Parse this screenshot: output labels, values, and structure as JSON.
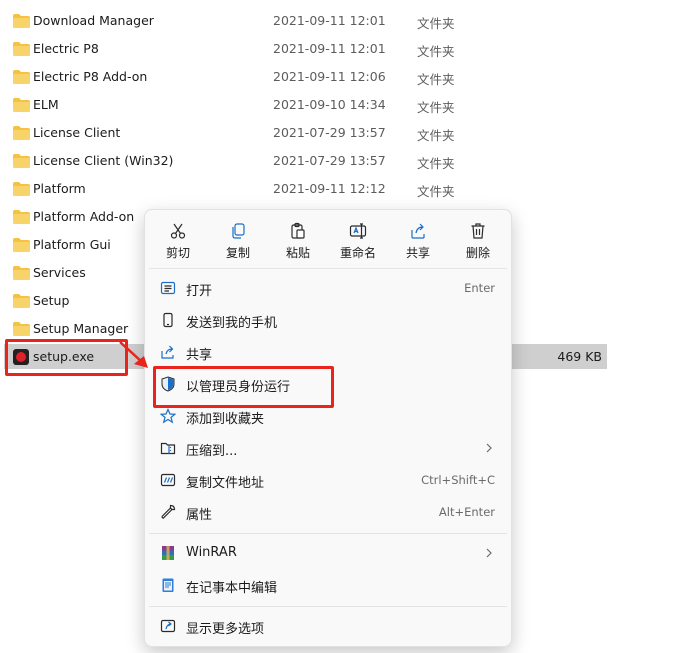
{
  "files": [
    {
      "name": "Download Manager",
      "date": "2021-09-11 12:01",
      "type": "文件夹",
      "icon": "folder-icon"
    },
    {
      "name": "Electric P8",
      "date": "2021-09-11 12:01",
      "type": "文件夹",
      "icon": "folder-icon"
    },
    {
      "name": "Electric P8 Add-on",
      "date": "2021-09-11 12:06",
      "type": "文件夹",
      "icon": "folder-icon"
    },
    {
      "name": "ELM",
      "date": "2021-09-10 14:34",
      "type": "文件夹",
      "icon": "folder-icon"
    },
    {
      "name": "License Client",
      "date": "2021-07-29 13:57",
      "type": "文件夹",
      "icon": "folder-icon"
    },
    {
      "name": "License Client (Win32)",
      "date": "2021-07-29 13:57",
      "type": "文件夹",
      "icon": "folder-icon"
    },
    {
      "name": "Platform",
      "date": "2021-09-11 12:12",
      "type": "文件夹",
      "icon": "folder-icon"
    },
    {
      "name": "Platform Add-on",
      "date": "",
      "type": "",
      "icon": "folder-icon"
    },
    {
      "name": "Platform Gui",
      "date": "",
      "type": "",
      "icon": "folder-icon"
    },
    {
      "name": "Services",
      "date": "",
      "type": "",
      "icon": "folder-icon"
    },
    {
      "name": "Setup",
      "date": "",
      "type": "",
      "icon": "folder-icon"
    },
    {
      "name": "Setup Manager",
      "date": "",
      "type": "",
      "icon": "folder-icon"
    }
  ],
  "selected_file": {
    "name": "setup.exe",
    "size": "469 KB",
    "icon": "exe-icon"
  },
  "context_menu": {
    "toolbar": [
      {
        "label": "剪切",
        "icon": "scissors-icon"
      },
      {
        "label": "复制",
        "icon": "copy-icon"
      },
      {
        "label": "粘贴",
        "icon": "paste-icon"
      },
      {
        "label": "重命名",
        "icon": "rename-icon"
      },
      {
        "label": "共享",
        "icon": "share-icon"
      },
      {
        "label": "删除",
        "icon": "trash-icon"
      }
    ],
    "items": [
      {
        "label": "打开",
        "shortcut": "Enter",
        "icon": "open-icon"
      },
      {
        "label": "发送到我的手机",
        "shortcut": "",
        "icon": "phone-icon"
      },
      {
        "label": "共享",
        "shortcut": "",
        "icon": "share-icon"
      },
      {
        "label": "以管理员身份运行",
        "shortcut": "",
        "icon": "shield-icon"
      },
      {
        "label": "添加到收藏夹",
        "shortcut": "",
        "icon": "star-icon"
      },
      {
        "label": "压缩到...",
        "shortcut": "",
        "icon": "zip-folder-icon",
        "has_submenu": true
      },
      {
        "label": "复制文件地址",
        "shortcut": "Ctrl+Shift+C",
        "icon": "copy-path-icon"
      },
      {
        "label": "属性",
        "shortcut": "Alt+Enter",
        "icon": "wrench-icon"
      },
      {
        "label": "WinRAR",
        "shortcut": "",
        "icon": "winrar-icon",
        "has_submenu": true
      },
      {
        "label": "在记事本中编辑",
        "shortcut": "",
        "icon": "notepad-icon"
      },
      {
        "label": "显示更多选项",
        "shortcut": "",
        "icon": "more-options-icon"
      }
    ]
  },
  "colors": {
    "highlight": "#e8241c",
    "folder": "#f5c242",
    "selection": "#cfcfcf",
    "accent": "#1a6ec7"
  }
}
